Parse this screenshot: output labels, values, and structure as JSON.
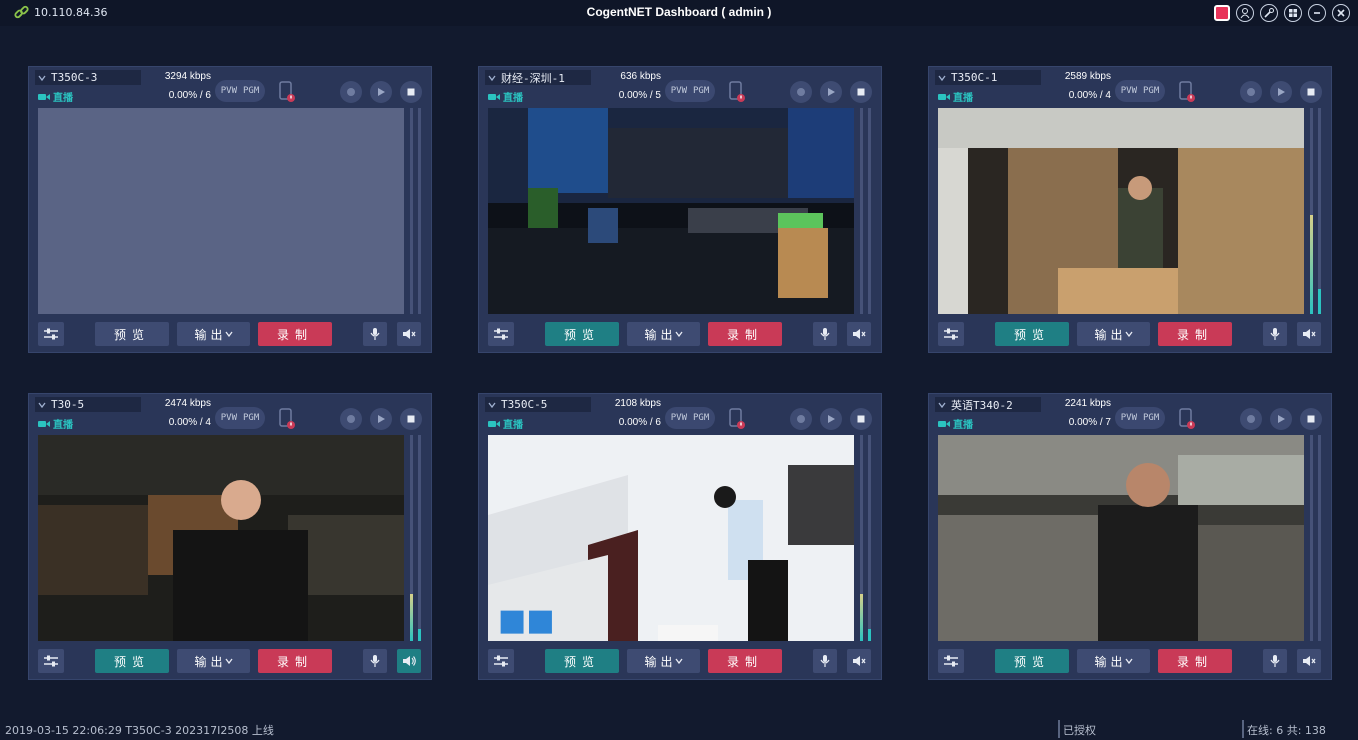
{
  "titlebar": {
    "ip": "10.110.84.36",
    "title": "CogentNET Dashboard ( admin )"
  },
  "colors": {
    "accent": "#2bc3c0",
    "record": "#c93a57",
    "panel": "#2a3658",
    "background": "#121a2e"
  },
  "panels": [
    {
      "name": "T350C-3",
      "kbps": "3294 kbps",
      "live": "直播",
      "progress": "0.00% / 6",
      "pvw": "PVW",
      "pgm": "PGM",
      "preview": "预览",
      "output": "输出",
      "record": "录制",
      "preview_active": false,
      "mute_active": false,
      "video": "blank",
      "vu_level": 0.0
    },
    {
      "name": "财经-深圳-1",
      "kbps": "636 kbps",
      "live": "直播",
      "progress": "0.00% / 5",
      "pvw": "PVW",
      "pgm": "PGM",
      "preview": "预览",
      "output": "输出",
      "record": "录制",
      "preview_active": true,
      "mute_active": false,
      "video": "office",
      "vu_level": 0.0
    },
    {
      "name": "T350C-1",
      "kbps": "2589 kbps",
      "live": "直播",
      "progress": "0.00% / 4",
      "pvw": "PVW",
      "pgm": "PGM",
      "preview": "预览",
      "output": "输出",
      "record": "录制",
      "preview_active": true,
      "mute_active": false,
      "video": "warehouse",
      "vu_level": 0.48
    },
    {
      "name": "T30-5",
      "kbps": "2474 kbps",
      "live": "直播",
      "progress": "0.00% / 4",
      "pvw": "PVW",
      "pgm": "PGM",
      "preview": "预览",
      "output": "输出",
      "record": "录制",
      "preview_active": true,
      "mute_active": true,
      "video": "dark-warehouse",
      "vu_level": 0.23
    },
    {
      "name": "T350C-5",
      "kbps": "2108 kbps",
      "live": "直播",
      "progress": "0.00% / 6",
      "pvw": "PVW",
      "pgm": "PGM",
      "preview": "预览",
      "output": "输出",
      "record": "录制",
      "preview_active": true,
      "mute_active": false,
      "video": "lobby",
      "vu_level": 0.23
    },
    {
      "name": "英语T340-2",
      "kbps": "2241 kbps",
      "live": "直播",
      "progress": "0.00% / 7",
      "pvw": "PVW",
      "pgm": "PGM",
      "preview": "预览",
      "output": "输出",
      "record": "录制",
      "preview_active": true,
      "mute_active": false,
      "video": "factory",
      "vu_level": 0.0
    }
  ],
  "statusbar": {
    "left": "2019-03-15 22:06:29 T350C-3 202317I2508 上线",
    "middle": "已授权",
    "right": "在线: 6 共: 138"
  }
}
